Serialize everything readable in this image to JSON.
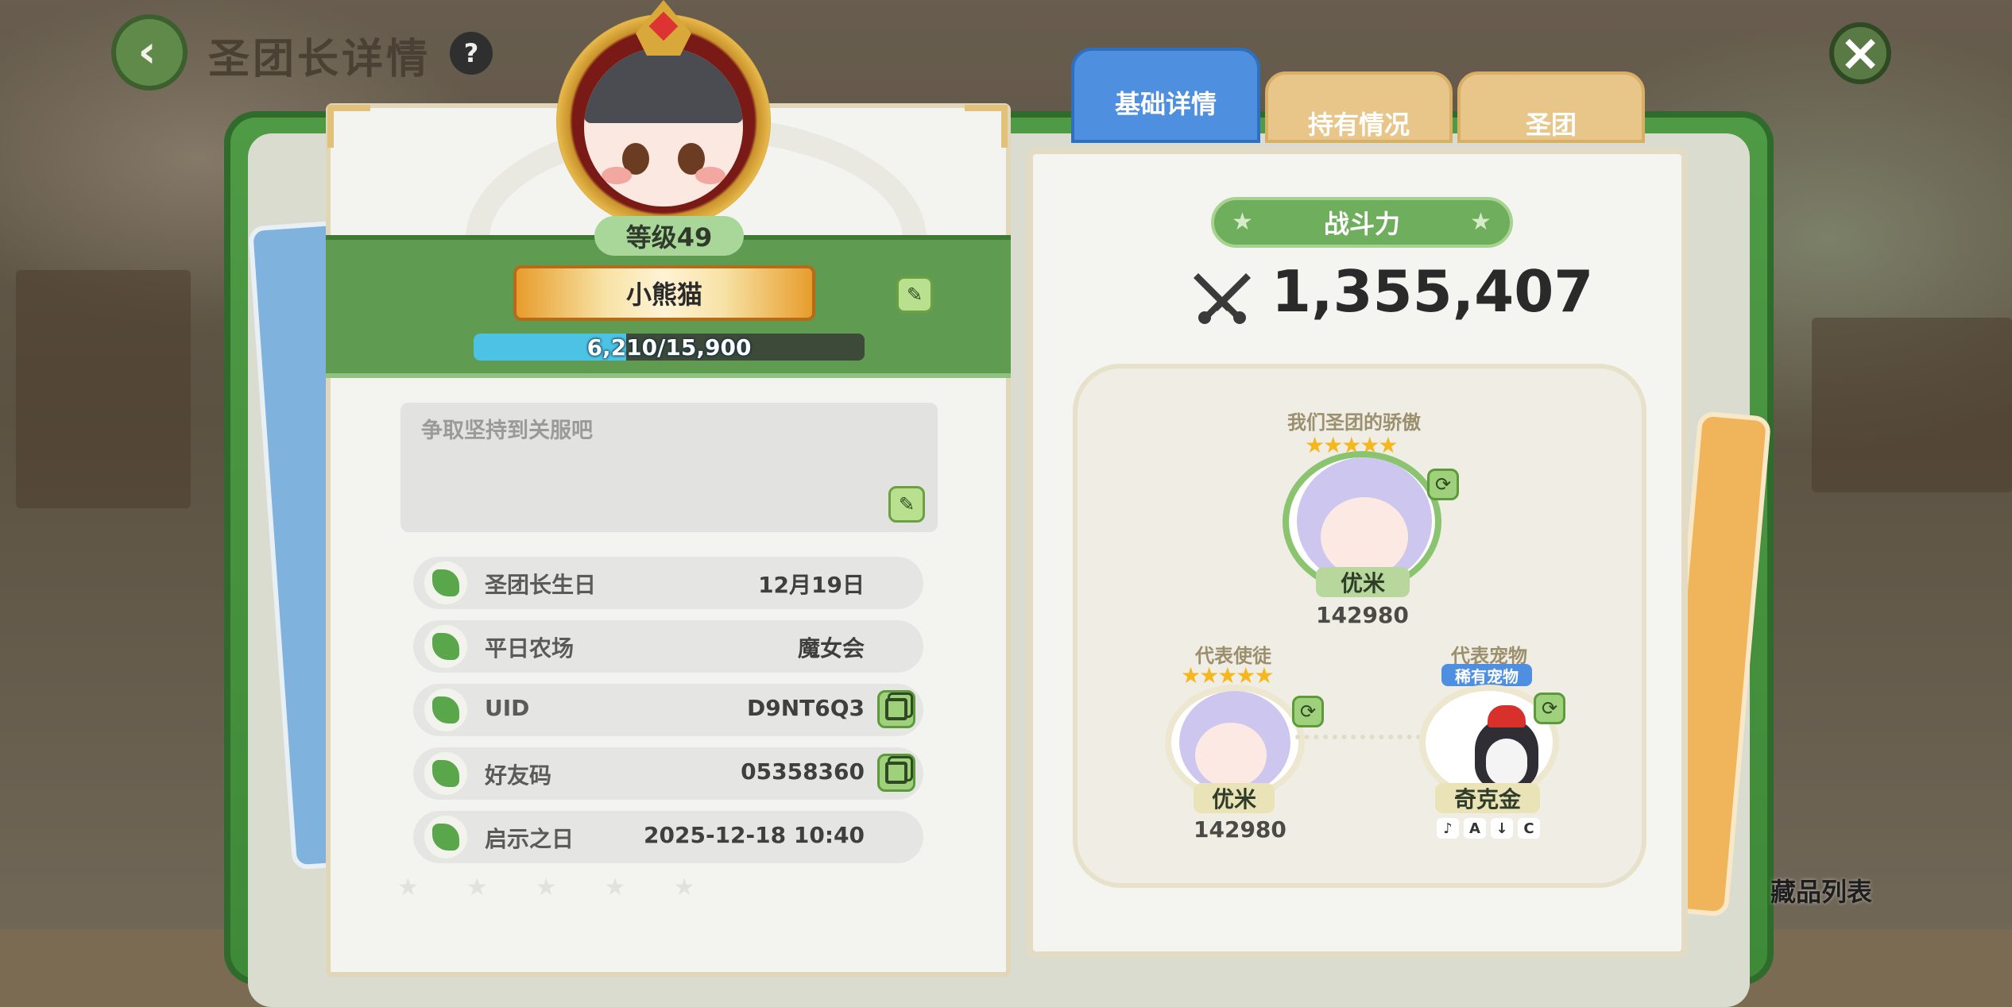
{
  "header": {
    "title": "圣团长详情",
    "help_icon": "?",
    "back_icon": "chevron-left",
    "close_icon": "close"
  },
  "profile": {
    "level_label": "等级49",
    "name": "小熊猫",
    "xp": {
      "text": "6,210/15,900",
      "current": 6210,
      "max": 15900
    },
    "motto": "争取坚持到关服吧",
    "info": [
      {
        "label": "圣团长生日",
        "value": "12月19日",
        "icon": "cake-icon",
        "copy": false
      },
      {
        "label": "平日农场",
        "value": "魔女会",
        "icon": "farm-icon",
        "copy": false
      },
      {
        "label": "UID",
        "value": "D9NT6Q3",
        "icon": "leaf-icon",
        "copy": true
      },
      {
        "label": "好友码",
        "value": "05358360",
        "icon": "clover-icon",
        "copy": true
      },
      {
        "label": "启示之日",
        "value": "2025-12-18 10:40",
        "icon": "sprout-icon",
        "copy": false
      }
    ]
  },
  "tabs": [
    {
      "label": "基础详情",
      "active": true
    },
    {
      "label": "持有情况",
      "active": false
    },
    {
      "label": "圣团",
      "active": false
    }
  ],
  "combat": {
    "label": "战斗力",
    "value": "1,355,407"
  },
  "pride": {
    "title": "我们圣团的骄傲",
    "hero": {
      "name": "优米",
      "power": "142980",
      "stars": "★★★★★"
    },
    "rep_apostle": {
      "label": "代表使徒",
      "name": "优米",
      "power": "142980",
      "stars": "★★★★★"
    },
    "rep_pet": {
      "label": "代表宠物",
      "badge": "稀有宠物",
      "name": "奇克金",
      "skills": [
        "♪",
        "A",
        "↓",
        "C"
      ]
    }
  },
  "footer": {
    "collection_label": "藏品列表"
  },
  "colors": {
    "accent_green": "#5f9b50",
    "tab_active": "#4f8fe0",
    "tab_inactive": "#e8c68a",
    "xp_fill": "#4cc3e4"
  }
}
